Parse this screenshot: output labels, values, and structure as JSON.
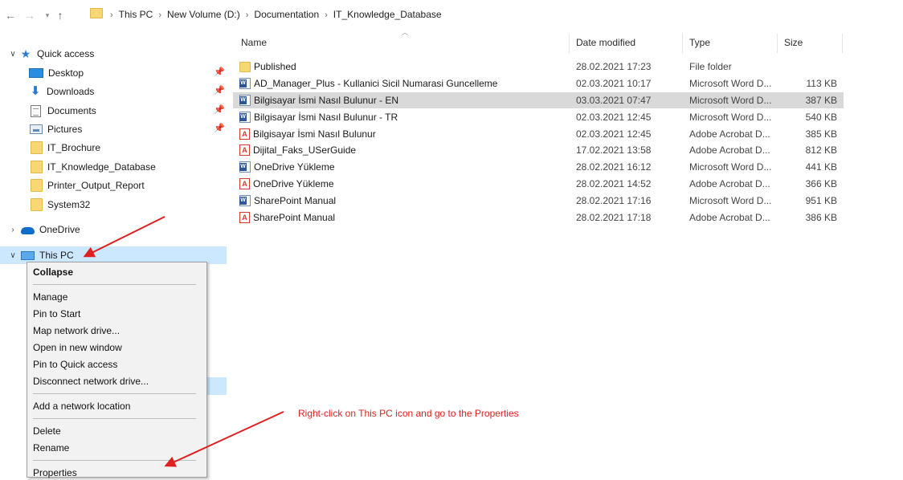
{
  "address_bar": {
    "back_icon": "arrow-left-icon",
    "forward_icon": "arrow-right-icon",
    "recent_icon": "chevron-down-icon",
    "up_icon": "arrow-up-icon",
    "breadcrumbs": [
      "This PC",
      "New Volume (D:)",
      "Documentation",
      "IT_Knowledge_Database"
    ],
    "separator": "›"
  },
  "sidebar": {
    "quick_access": "Quick access",
    "items": [
      {
        "label": "Desktop",
        "icon": "desktop-icon",
        "pinned": true
      },
      {
        "label": "Downloads",
        "icon": "download-icon",
        "pinned": true
      },
      {
        "label": "Documents",
        "icon": "documents-icon",
        "pinned": true
      },
      {
        "label": "Pictures",
        "icon": "pictures-icon",
        "pinned": true
      },
      {
        "label": "IT_Brochure",
        "icon": "folder-icon",
        "pinned": false
      },
      {
        "label": "IT_Knowledge_Database",
        "icon": "folder-icon",
        "pinned": false
      },
      {
        "label": "Printer_Output_Report",
        "icon": "folder-icon",
        "pinned": false
      },
      {
        "label": "System32",
        "icon": "folder-icon",
        "pinned": false
      }
    ],
    "onedrive": "OneDrive",
    "this_pc": "This PC",
    "pin_glyph": "📌"
  },
  "context_menu": {
    "items": [
      {
        "label": "Collapse",
        "bold": true
      },
      {
        "separator": true
      },
      {
        "label": "Manage"
      },
      {
        "label": "Pin to Start"
      },
      {
        "label": "Map network drive..."
      },
      {
        "label": "Open in new window"
      },
      {
        "label": "Pin to Quick access"
      },
      {
        "label": "Disconnect network drive..."
      },
      {
        "separator": true
      },
      {
        "label": "Add a network location"
      },
      {
        "separator": true
      },
      {
        "label": "Delete"
      },
      {
        "label": "Rename"
      },
      {
        "separator": true
      },
      {
        "label": "Properties"
      }
    ]
  },
  "file_list": {
    "columns": {
      "name": "Name",
      "date": "Date modified",
      "type": "Type",
      "size": "Size"
    },
    "rows": [
      {
        "name": "Published",
        "date": "28.02.2021 17:23",
        "type": "File folder",
        "size": "",
        "kind": "folder"
      },
      {
        "name": "AD_Manager_Plus - Kullanici Sicil Numarasi Guncelleme",
        "date": "02.03.2021 10:17",
        "type": "Microsoft Word D...",
        "size": "113 KB",
        "kind": "word"
      },
      {
        "name": "Bilgisayar İsmi Nasıl Bulunur - EN",
        "date": "03.03.2021 07:47",
        "type": "Microsoft Word D...",
        "size": "387 KB",
        "kind": "word",
        "selected": true
      },
      {
        "name": "Bilgisayar İsmi Nasıl Bulunur - TR",
        "date": "02.03.2021 12:45",
        "type": "Microsoft Word D...",
        "size": "540 KB",
        "kind": "word"
      },
      {
        "name": "Bilgisayar İsmi Nasıl Bulunur",
        "date": "02.03.2021 12:45",
        "type": "Adobe Acrobat D...",
        "size": "385 KB",
        "kind": "pdf"
      },
      {
        "name": "Dijital_Faks_USerGuide",
        "date": "17.02.2021 13:58",
        "type": "Adobe Acrobat D...",
        "size": "812 KB",
        "kind": "pdf"
      },
      {
        "name": "OneDrive Yükleme",
        "date": "28.02.2021 16:12",
        "type": "Microsoft Word D...",
        "size": "441 KB",
        "kind": "word"
      },
      {
        "name": "OneDrive Yükleme",
        "date": "28.02.2021 14:52",
        "type": "Adobe Acrobat D...",
        "size": "366 KB",
        "kind": "pdf"
      },
      {
        "name": "SharePoint Manual",
        "date": "28.02.2021 17:16",
        "type": "Microsoft Word D...",
        "size": "951 KB",
        "kind": "word"
      },
      {
        "name": "SharePoint Manual",
        "date": "28.02.2021 17:18",
        "type": "Adobe Acrobat D...",
        "size": "386 KB",
        "kind": "pdf"
      }
    ]
  },
  "annotation": {
    "text": "Right-click on This PC icon and go to the Properties",
    "color": "#e02020"
  },
  "colors": {
    "selection": "#cce8ff",
    "row_selected": "#d9d9d9",
    "folder": "#f8d775",
    "accent": "#2a7ad6"
  }
}
